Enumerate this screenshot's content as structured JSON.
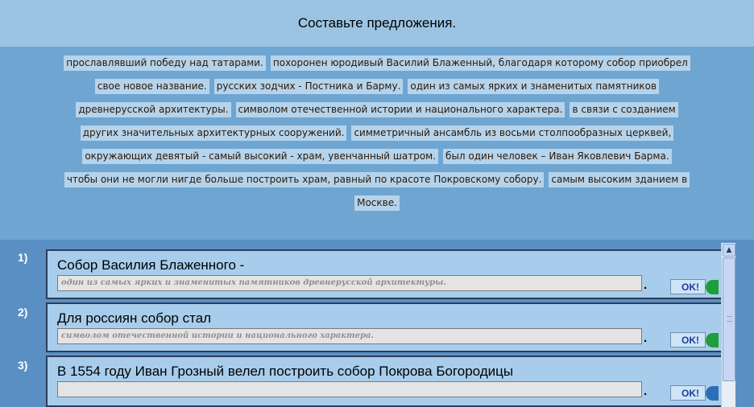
{
  "header": {
    "title": "Составьте предложения."
  },
  "bank": {
    "lines": [
      [
        "прославлявший победу над татарами.",
        "похоронен юродивый Василий Блаженный, благодаря которому собор приобрел"
      ],
      [
        "свое новое название.",
        "русских зодчих - Постника и Барму.",
        "один из самых ярких и знаменитых памятников"
      ],
      [
        "древнерусской архитектуры.",
        "символом отечественной истории и национального характера.",
        "в связи с созданием"
      ],
      [
        "других значительных архитектурных сооружений.",
        "симметричный ансамбль из восьми столпообразных церквей,"
      ],
      [
        "окружающих девятый - самый высокий - храм, увенчанный шатром.",
        "был один человек – Иван Яковлевич Барма."
      ],
      [
        "чтобы они не могли нигде больше построить храм, равный по красоте Покровскому собору.",
        "самым высоким зданием в"
      ],
      [
        "Москве."
      ]
    ]
  },
  "tasks": [
    {
      "number": "1)",
      "prompt": "Собор Василия Блаженного -",
      "answer": "один из самых ярких и знаменитых памятников древнерусской архитектуры.",
      "dot": ".",
      "ok_label": "OK!",
      "status_color": "#1f9d3a"
    },
    {
      "number": "2)",
      "prompt": "Для россиян собор стал",
      "answer": "символом отечественной истории и национального характера.",
      "dot": ".",
      "ok_label": "OK!",
      "status_color": "#1f9d3a"
    },
    {
      "number": "3)",
      "prompt": "В 1554 году Иван Грозный велел построить собор Покрова Богородицы",
      "answer": "",
      "dot": ".",
      "ok_label": "OK!",
      "status_color": "#2a6fb8"
    }
  ],
  "scrollbar": {
    "up_icon": "chevron-up-icon"
  }
}
